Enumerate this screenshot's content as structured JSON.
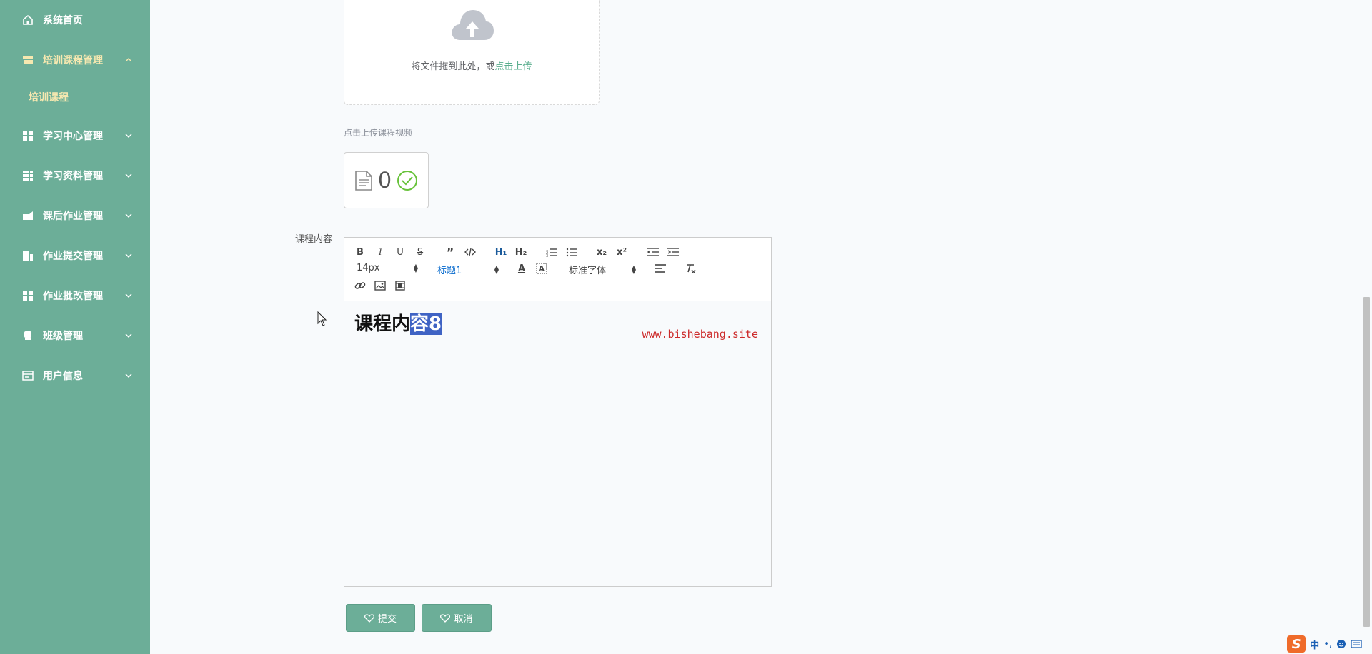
{
  "sidebar": {
    "items": [
      {
        "label": "系统首页",
        "icon": "home-icon"
      },
      {
        "label": "培训课程管理",
        "icon": "course-icon",
        "expanded": true
      },
      {
        "label": "学习中心管理",
        "icon": "grid-icon"
      },
      {
        "label": "学习资料管理",
        "icon": "table-icon"
      },
      {
        "label": "课后作业管理",
        "icon": "homework-icon"
      },
      {
        "label": "作业提交管理",
        "icon": "chart-icon"
      },
      {
        "label": "作业批改管理",
        "icon": "grid-icon"
      },
      {
        "label": "班级管理",
        "icon": "class-icon"
      },
      {
        "label": "用户信息",
        "icon": "user-card-icon"
      }
    ],
    "sub_item": "培训课程"
  },
  "upload": {
    "text": "将文件拖到此处，或",
    "link": "点击上传",
    "tip": "点击上传课程视频",
    "file_count": "0"
  },
  "form": {
    "content_label": "课程内容"
  },
  "editor": {
    "font_size": "14px",
    "header": "标题1",
    "font_family": "标准字体",
    "content_plain": "课程内",
    "content_selected": "容8",
    "watermark": "www.bishebang.site"
  },
  "buttons": {
    "submit": "提交",
    "cancel": "取消"
  },
  "ime": {
    "lang": "中"
  },
  "colors": {
    "sidebar": "#6cae98",
    "active_text": "#f6e8b0",
    "link": "#5aae8e",
    "selection": "#3f63c4"
  }
}
